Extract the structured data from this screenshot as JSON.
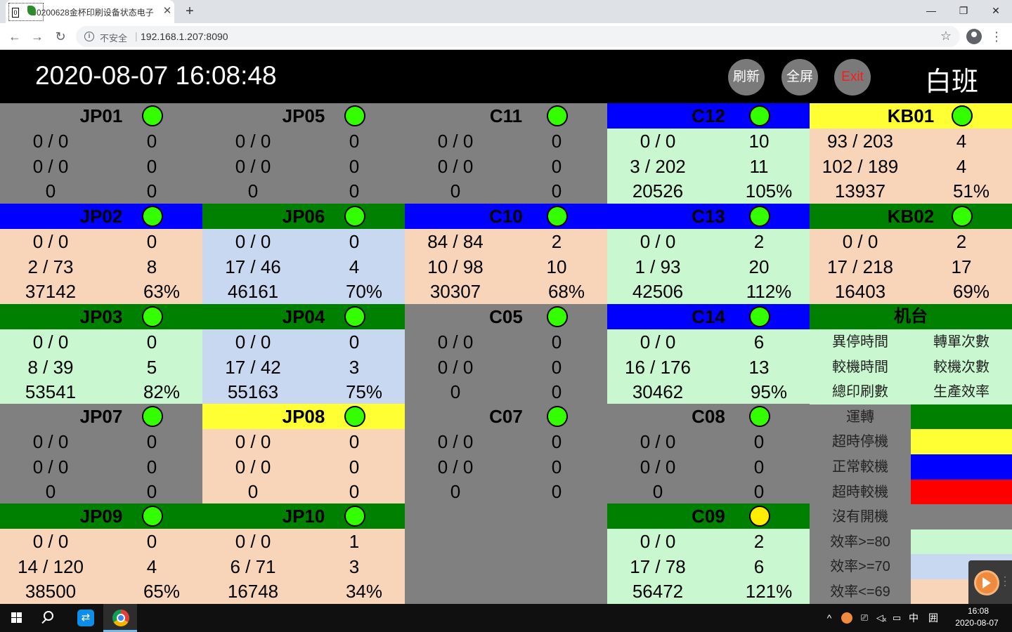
{
  "browser": {
    "tab_title": "0200628金杯印刷设备状态电子",
    "tab_close": "✕",
    "newtab": "+",
    "insecure_label": "不安全",
    "url": "192.168.1.207:8090",
    "win_min": "—",
    "win_max": "❐",
    "win_close": "✕",
    "back": "←",
    "forward": "→",
    "reload": "↻",
    "star": "☆",
    "menu": "⋮"
  },
  "header": {
    "datetime": "2020-08-07 16:08:48",
    "refresh_label": "刷新",
    "fullscreen_label": "全屏",
    "exit_label": "Exit",
    "shift_label": "白班"
  },
  "colors": {
    "run": "#008000",
    "timeout_stop": "#ffff33",
    "normal_calibrate": "#0000ff",
    "timeout_calibrate": "#ff0000",
    "off": "#808080",
    "eff80": "#c8f7d0",
    "eff70": "#c8d8f0",
    "eff69": "#f8d5b8",
    "lamp_green": "#33ff00",
    "lamp_yellow": "#ffee00"
  },
  "machines": [
    {
      "name": "JP01",
      "head": "#808080",
      "body": "#808080",
      "lamp": "#33ff00",
      "r1l": "0 / 0",
      "r1r": "0",
      "r2l": "0 / 0",
      "r2r": "0",
      "r3l": "0",
      "r3r": "0"
    },
    {
      "name": "JP05",
      "head": "#808080",
      "body": "#808080",
      "lamp": "#33ff00",
      "r1l": "0 / 0",
      "r1r": "0",
      "r2l": "0 / 0",
      "r2r": "0",
      "r3l": "0",
      "r3r": "0"
    },
    {
      "name": "C11",
      "head": "#808080",
      "body": "#808080",
      "lamp": "#33ff00",
      "r1l": "0 / 0",
      "r1r": "0",
      "r2l": "0 / 0",
      "r2r": "0",
      "r3l": "0",
      "r3r": "0"
    },
    {
      "name": "C12",
      "head": "#0000ff",
      "body": "#c8f7d0",
      "lamp": "#33ff00",
      "r1l": "0 / 0",
      "r1r": "10",
      "r2l": "3 / 202",
      "r2r": "11",
      "r3l": "20526",
      "r3r": "105%"
    },
    {
      "name": "KB01",
      "head": "#ffff33",
      "body": "#f8d5b8",
      "lamp": "#33ff00",
      "r1l": "93 / 203",
      "r1r": "4",
      "r2l": "102 / 189",
      "r2r": "4",
      "r3l": "13937",
      "r3r": "51%"
    },
    {
      "name": "JP02",
      "head": "#0000ff",
      "body": "#f8d5b8",
      "lamp": "#33ff00",
      "r1l": "0 / 0",
      "r1r": "0",
      "r2l": "2 / 73",
      "r2r": "8",
      "r3l": "37142",
      "r3r": "63%"
    },
    {
      "name": "JP06",
      "head": "#008000",
      "body": "#c8d8f0",
      "lamp": "#33ff00",
      "r1l": "0 / 0",
      "r1r": "0",
      "r2l": "17 / 46",
      "r2r": "4",
      "r3l": "46161",
      "r3r": "70%"
    },
    {
      "name": "C10",
      "head": "#0000ff",
      "body": "#f8d5b8",
      "lamp": "#33ff00",
      "r1l": "84 / 84",
      "r1r": "2",
      "r2l": "10 / 98",
      "r2r": "10",
      "r3l": "30307",
      "r3r": "68%"
    },
    {
      "name": "C13",
      "head": "#0000ff",
      "body": "#c8f7d0",
      "lamp": "#33ff00",
      "r1l": "0 / 0",
      "r1r": "2",
      "r2l": "1 / 93",
      "r2r": "20",
      "r3l": "42506",
      "r3r": "112%"
    },
    {
      "name": "KB02",
      "head": "#008000",
      "body": "#f8d5b8",
      "lamp": "#33ff00",
      "r1l": "0 / 0",
      "r1r": "2",
      "r2l": "17 / 218",
      "r2r": "17",
      "r3l": "16403",
      "r3r": "69%"
    },
    {
      "name": "JP03",
      "head": "#008000",
      "body": "#c8f7d0",
      "lamp": "#33ff00",
      "r1l": "0 / 0",
      "r1r": "0",
      "r2l": "8 / 39",
      "r2r": "5",
      "r3l": "53541",
      "r3r": "82%"
    },
    {
      "name": "JP04",
      "head": "#008000",
      "body": "#c8d8f0",
      "lamp": "#33ff00",
      "r1l": "0 / 0",
      "r1r": "0",
      "r2l": "17 / 42",
      "r2r": "3",
      "r3l": "55163",
      "r3r": "75%"
    },
    {
      "name": "C05",
      "head": "#808080",
      "body": "#808080",
      "lamp": "#33ff00",
      "r1l": "0 / 0",
      "r1r": "0",
      "r2l": "0 / 0",
      "r2r": "0",
      "r3l": "0",
      "r3r": "0"
    },
    {
      "name": "C14",
      "head": "#0000ff",
      "body": "#c8f7d0",
      "lamp": "#33ff00",
      "r1l": "0 / 0",
      "r1r": "6",
      "r2l": "16 / 176",
      "r2r": "13",
      "r3l": "30462",
      "r3r": "95%"
    },
    null,
    {
      "name": "JP07",
      "head": "#808080",
      "body": "#808080",
      "lamp": "#33ff00",
      "r1l": "0 / 0",
      "r1r": "0",
      "r2l": "0 / 0",
      "r2r": "0",
      "r3l": "0",
      "r3r": "0"
    },
    {
      "name": "JP08",
      "head": "#ffff33",
      "body": "#f8d5b8",
      "lamp": "#33ff00",
      "r1l": "0 / 0",
      "r1r": "0",
      "r2l": "0 / 0",
      "r2r": "0",
      "r3l": "0",
      "r3r": "0"
    },
    {
      "name": "C07",
      "head": "#808080",
      "body": "#808080",
      "lamp": "#33ff00",
      "r1l": "0 / 0",
      "r1r": "0",
      "r2l": "0 / 0",
      "r2r": "0",
      "r3l": "0",
      "r3r": "0"
    },
    {
      "name": "C08",
      "head": "#808080",
      "body": "#808080",
      "lamp": "#33ff00",
      "r1l": "0 / 0",
      "r1r": "0",
      "r2l": "0 / 0",
      "r2r": "0",
      "r3l": "0",
      "r3r": "0"
    },
    null,
    {
      "name": "JP09",
      "head": "#008000",
      "body": "#f8d5b8",
      "lamp": "#33ff00",
      "r1l": "0 / 0",
      "r1r": "0",
      "r2l": "14 / 120",
      "r2r": "4",
      "r3l": "38500",
      "r3r": "65%"
    },
    {
      "name": "JP10",
      "head": "#008000",
      "body": "#f8d5b8",
      "lamp": "#33ff00",
      "r1l": "0 / 0",
      "r1r": "1",
      "r2l": "6 / 71",
      "r2r": "3",
      "r3l": "16748",
      "r3r": "34%"
    },
    null,
    {
      "name": "C09",
      "head": "#008000",
      "body": "#c8f7d0",
      "lamp": "#ffee00",
      "r1l": "0 / 0",
      "r1r": "2",
      "r2l": "17 / 78",
      "r2r": "6",
      "r3l": "56472",
      "r3r": "121%"
    },
    null
  ],
  "legend": {
    "title": "机台",
    "info": [
      [
        "異停時間",
        "轉單次數"
      ],
      [
        "較機時間",
        "較機次數"
      ],
      [
        "總印刷數",
        "生產效率"
      ]
    ],
    "items": [
      {
        "label": "運轉",
        "color": "#008000"
      },
      {
        "label": "超時停機",
        "color": "#ffff33"
      },
      {
        "label": "正常較機",
        "color": "#0000ff"
      },
      {
        "label": "超時較機",
        "color": "#ff0000"
      },
      {
        "label": "沒有開機",
        "color": "#808080"
      },
      {
        "label": "效率>=80",
        "color": "#c8f7d0"
      },
      {
        "label": "效率>=70",
        "color": "#c8d8f0"
      },
      {
        "label": "效率<=69",
        "color": "#f8d5b8"
      }
    ]
  },
  "taskbar": {
    "tray_chevron": "^",
    "ime": "中",
    "ime_mode": "囲",
    "clock_time": "16:08",
    "clock_date": "2020-08-07"
  }
}
